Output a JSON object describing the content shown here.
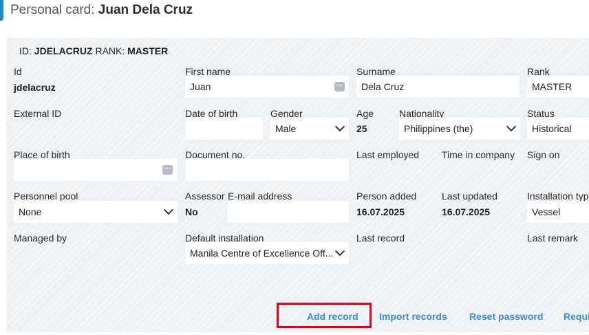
{
  "header": {
    "title_prefix": "Personal card:",
    "title_name": "Juan Dela Cruz"
  },
  "id_line": {
    "id_label": "ID:",
    "id_value": "JDELACRUZ",
    "rank_label": "RANK:",
    "rank_value": "MASTER"
  },
  "fields": {
    "id": {
      "label": "Id",
      "value": "jdelacruz"
    },
    "first_name": {
      "label": "First name",
      "value": "Juan"
    },
    "surname": {
      "label": "Surname",
      "value": "Dela Cruz"
    },
    "rank": {
      "label": "Rank",
      "value": "MASTER"
    },
    "external_id": {
      "label": "External ID"
    },
    "date_of_birth": {
      "label": "Date of birth",
      "value": ""
    },
    "gender": {
      "label": "Gender",
      "value": "Male"
    },
    "age": {
      "label": "Age",
      "value": "25"
    },
    "nationality": {
      "label": "Nationality",
      "value": "Philippines (the)"
    },
    "status": {
      "label": "Status",
      "value": "Historical"
    },
    "place_of_birth": {
      "label": "Place of birth",
      "value": ""
    },
    "document_no": {
      "label": "Document no.",
      "value": ""
    },
    "last_employed": {
      "label": "Last employed"
    },
    "time_in_company": {
      "label": "Time in company"
    },
    "sign_on": {
      "label": "Sign on"
    },
    "personnel_pool": {
      "label": "Personnel pool",
      "value": "None"
    },
    "assessor": {
      "label": "Assessor",
      "value": "No"
    },
    "email": {
      "label": "E-mail address",
      "value": ""
    },
    "person_added": {
      "label": "Person added",
      "value": "16.07.2025"
    },
    "last_updated": {
      "label": "Last updated",
      "value": "16.07.2025"
    },
    "installation_type": {
      "label": "Installation typ",
      "value": "Vessel"
    },
    "managed_by": {
      "label": "Managed by"
    },
    "default_installation": {
      "label": "Default installation",
      "value": "Manila Centre of Excellence Off..."
    },
    "last_record": {
      "label": "Last record"
    },
    "last_remark": {
      "label": "Last remark"
    }
  },
  "actions": {
    "add_record": "Add record",
    "import_records": "Import records",
    "reset_password": "Reset password",
    "requi": "Requi"
  },
  "colors": {
    "accent": "#1e88c9",
    "link": "#3a8ed6",
    "highlight": "#e3001b"
  }
}
